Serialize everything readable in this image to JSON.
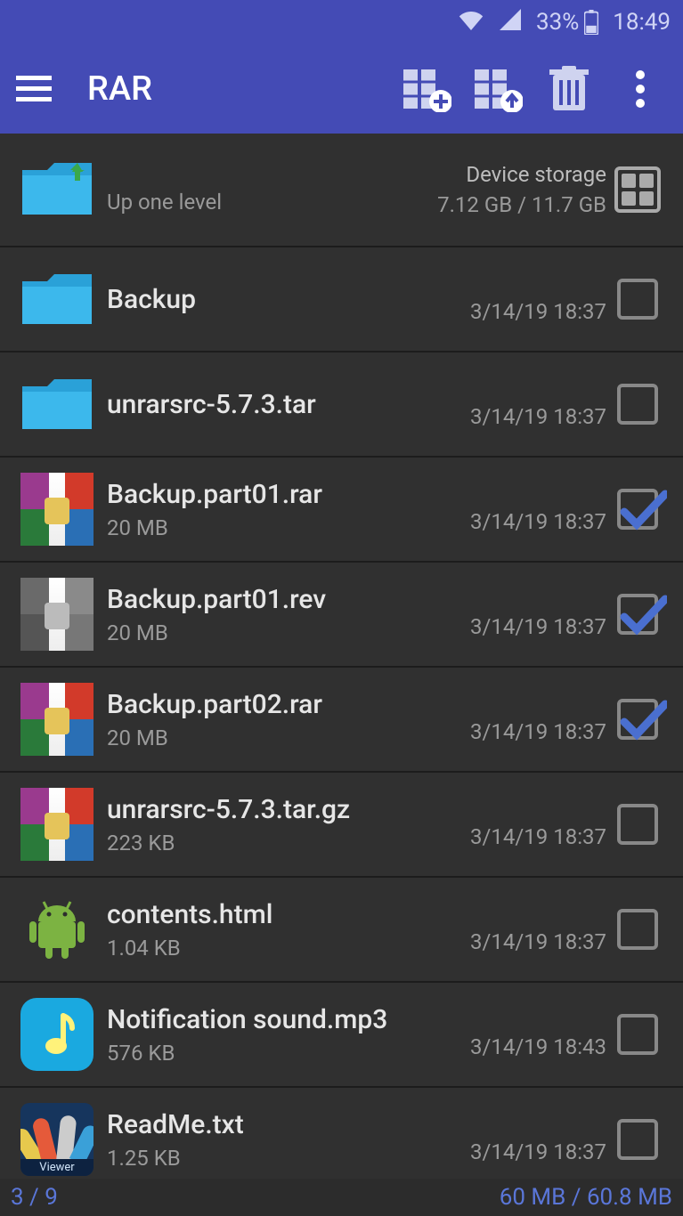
{
  "status": {
    "battery_pct": "33%",
    "time": "18:49"
  },
  "appbar": {
    "title": "RAR"
  },
  "up": {
    "label": "Up one level",
    "storage_label": "Device storage",
    "storage_usage": "7.12 GB / 11.7 GB"
  },
  "items": [
    {
      "name": "Backup",
      "size": "",
      "date": "3/14/19 18:37",
      "icon": "folder",
      "checked": false
    },
    {
      "name": "unrarsrc-5.7.3.tar",
      "size": "",
      "date": "3/14/19 18:37",
      "icon": "folder",
      "checked": false
    },
    {
      "name": "Backup.part01.rar",
      "size": "20 MB",
      "date": "3/14/19 18:37",
      "icon": "rar",
      "checked": true
    },
    {
      "name": "Backup.part01.rev",
      "size": "20 MB",
      "date": "3/14/19 18:37",
      "icon": "rev",
      "checked": true
    },
    {
      "name": "Backup.part02.rar",
      "size": "20 MB",
      "date": "3/14/19 18:37",
      "icon": "rar",
      "checked": true
    },
    {
      "name": "unrarsrc-5.7.3.tar.gz",
      "size": "223 KB",
      "date": "3/14/19 18:37",
      "icon": "rar",
      "checked": false
    },
    {
      "name": "contents.html",
      "size": "1.04 KB",
      "date": "3/14/19 18:37",
      "icon": "android",
      "checked": false
    },
    {
      "name": "Notification sound.mp3",
      "size": "576 KB",
      "date": "3/14/19 18:43",
      "icon": "music",
      "checked": false
    },
    {
      "name": "ReadMe.txt",
      "size": "1.25 KB",
      "date": "3/14/19 18:37",
      "icon": "viewer",
      "checked": false
    }
  ],
  "footer": {
    "selection": "3 / 9",
    "size": "60 MB / 60.8 MB"
  },
  "viewer_label": "Viewer"
}
